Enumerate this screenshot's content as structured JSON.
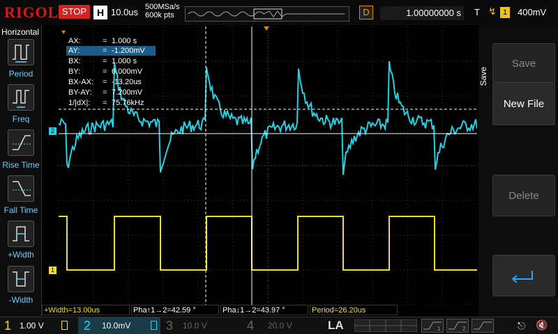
{
  "topbar": {
    "brand": "RIGOL",
    "run_state": "STOP",
    "horizontal_label": "H",
    "timebase": "10.0us",
    "sample_rate": "500MSa/s",
    "memory_depth": "600k pts",
    "delay_label": "D",
    "delay_value": "1.00000000 s",
    "trigger_label": "T",
    "trigger_source": "1",
    "trigger_level": "400mV"
  },
  "left_menu": {
    "title": "Horizontal",
    "items": [
      {
        "label": "Period",
        "icon": "period-icon"
      },
      {
        "label": "Freq",
        "icon": "freq-icon"
      },
      {
        "label": "Rise Time",
        "icon": "rise-time-icon"
      },
      {
        "label": "Fall Time",
        "icon": "fall-time-icon"
      },
      {
        "label": "+Width",
        "icon": "plus-width-icon"
      },
      {
        "label": "-Width",
        "icon": "minus-width-icon"
      }
    ]
  },
  "cursor_readout": [
    {
      "key": "AX:",
      "value": "1.000 s"
    },
    {
      "key": "AY:",
      "value": "-1.200mV"
    },
    {
      "key": "BX:",
      "value": "1.000 s"
    },
    {
      "key": "BY:",
      "value": "6.000mV"
    },
    {
      "key": "BX-AX:",
      "value": "-13.20us"
    },
    {
      "key": "BY-AY:",
      "value": "7.200mV"
    },
    {
      "key": "1/|dX|:",
      "value": "75.76kHz"
    }
  ],
  "channel_markers": {
    "ch2": "2",
    "ch1": "1",
    "trigger": "T"
  },
  "right_menu": {
    "title": "Save",
    "save": "Save",
    "new_file": "New File",
    "delete": "Delete"
  },
  "measurements": [
    "+Width=13.00us",
    "Pha↑1→2=42.59 °",
    "Pha↓1→2=43.97 °",
    "Period=26.20us"
  ],
  "bottom_bar": {
    "ch1": {
      "num": "1",
      "scale": "1.00 V",
      "color": "#f1e020"
    },
    "ch2": {
      "num": "2",
      "scale": "10.0mV",
      "color": "#20d4e6"
    },
    "ch3": {
      "num": "3",
      "scale": "10.0 V",
      "color": "#666666"
    },
    "ch4": {
      "num": "4",
      "scale": "20.0 V",
      "color": "#666666"
    },
    "la": "LA",
    "la_digits": "0 1 2 3 4 5 6 7 / 8 9 10 11 12 13 14 15"
  },
  "colors": {
    "ch1": "#f1e020",
    "ch2": "#20d4e6",
    "accent": "#e8840a",
    "stop": "#d32424"
  }
}
